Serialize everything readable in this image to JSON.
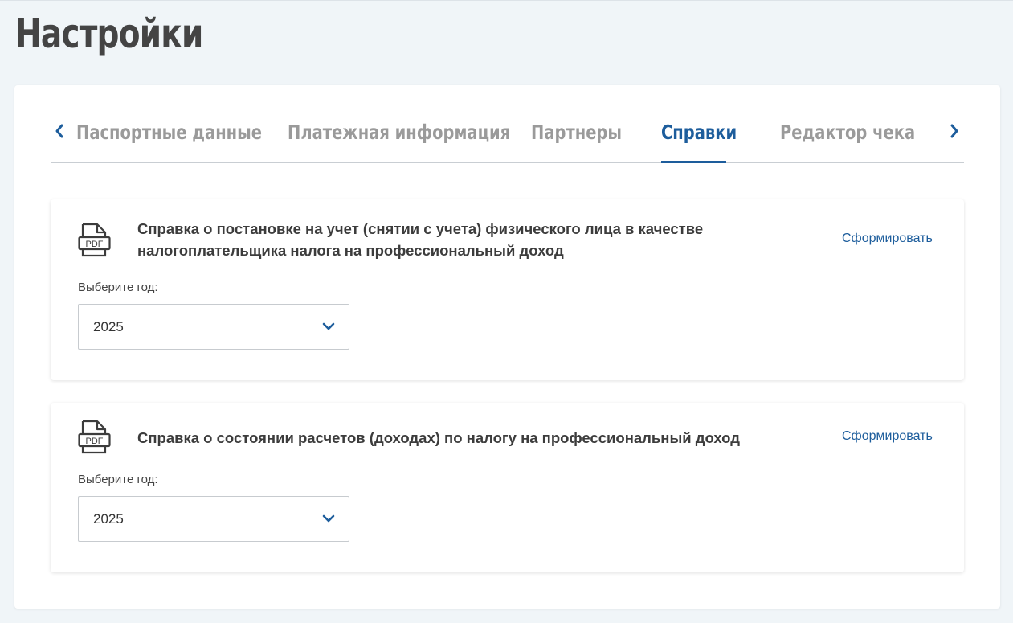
{
  "page": {
    "title": "Настройки"
  },
  "tabs": {
    "items": [
      {
        "label": "Паспортные данные"
      },
      {
        "label": "Платежная информация"
      },
      {
        "label": "Партнеры"
      },
      {
        "label": "Справки"
      },
      {
        "label": "Редактор чека"
      }
    ],
    "active": "Справки"
  },
  "cards": [
    {
      "icon": "pdf-file-icon",
      "icon_text": "PDF",
      "title": "Справка о постановке на учет (снятии с учета) физического лица в качестве налогоплательщика налога на профессиональный доход",
      "action": "Сформировать",
      "year_label": "Выберите год:",
      "year_value": "2025"
    },
    {
      "icon": "pdf-file-icon",
      "icon_text": "PDF",
      "title": "Справка о состоянии расчетов (доходах) по налогу на профессиональный доход",
      "action": "Сформировать",
      "year_label": "Выберите год:",
      "year_value": "2025"
    }
  ],
  "colors": {
    "accent": "#1d5d9c",
    "background": "#f0f5f8",
    "inactive_tab": "#9a9a9a"
  }
}
